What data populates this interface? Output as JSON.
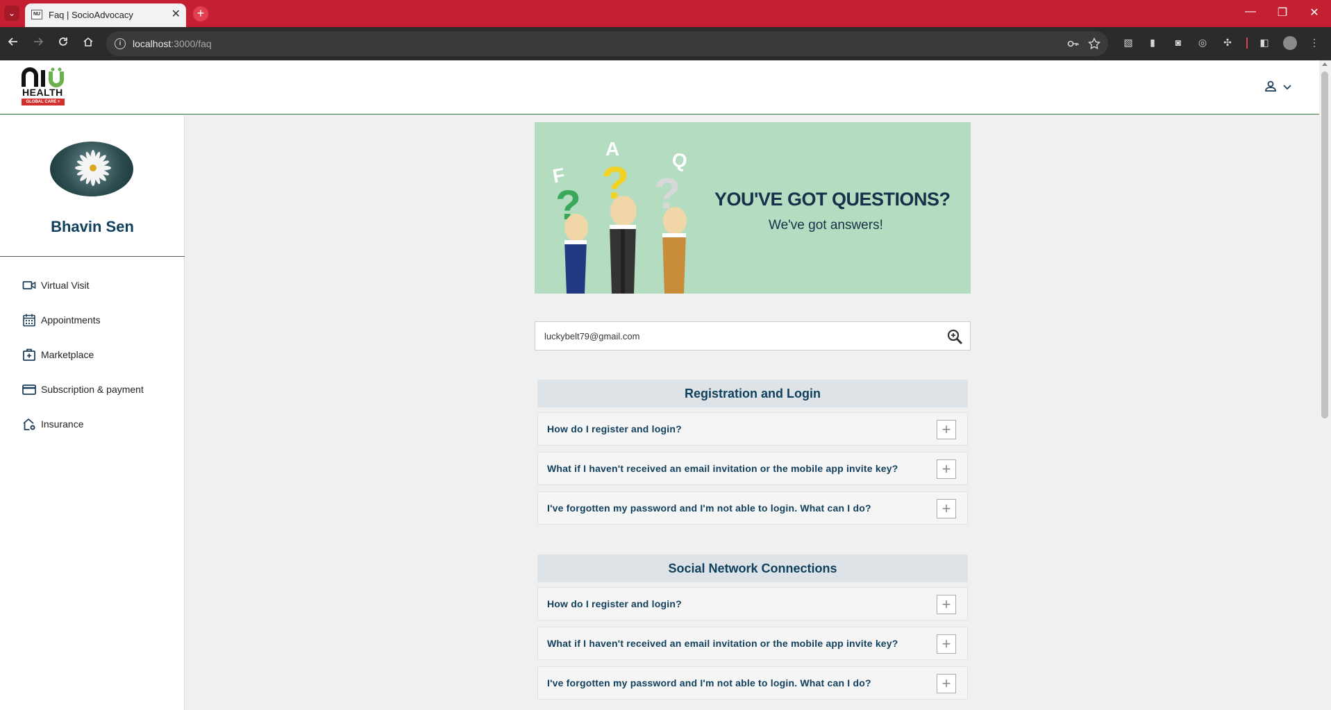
{
  "browser": {
    "tab_title": "Faq | SocioAdvocacy",
    "favicon_text": "NU",
    "url_host": "localhost",
    "url_path": ":3000/faq",
    "close_glyph": "✕",
    "new_tab_glyph": "+",
    "minimize_glyph": "—",
    "restore_glyph": "❐",
    "window_close_glyph": "✕"
  },
  "app": {
    "logo_mark": "NU",
    "logo_name": "HEALTH",
    "logo_tagline": "GLOBAL CARE +"
  },
  "profile": {
    "name": "Bhavin Sen"
  },
  "sidebar": {
    "items": [
      {
        "label": "Virtual Visit",
        "icon": "video-camera-icon"
      },
      {
        "label": "Appointments",
        "icon": "calendar-icon"
      },
      {
        "label": "Marketplace",
        "icon": "medical-bag-icon"
      },
      {
        "label": "Subscription & payment",
        "icon": "credit-card-icon"
      },
      {
        "label": "Insurance",
        "icon": "home-shield-icon"
      }
    ]
  },
  "banner": {
    "title": "YOU'VE GOT QUESTIONS?",
    "subtitle": "We've got answers!",
    "letters": [
      "F",
      "A",
      "Q"
    ]
  },
  "search": {
    "value": "luckybelt79@gmail.com"
  },
  "faq": {
    "sections": [
      {
        "title": "Registration and Login",
        "items": [
          "How do I register and login?",
          "What if I haven't received an email invitation or the mobile app invite key?",
          "I've forgotten my password and I'm not able to login. What can I do?"
        ]
      },
      {
        "title": "Social Network Connections",
        "items": [
          "How do I register and login?",
          "What if I haven't received an email invitation or the mobile app invite key?",
          "I've forgotten my password and I'm not able to login. What can I do?"
        ]
      }
    ],
    "expand_glyph": "+"
  },
  "colors": {
    "brand_red": "#c42031",
    "navy": "#0f3f5c",
    "banner_green": "#b4dcc0"
  }
}
